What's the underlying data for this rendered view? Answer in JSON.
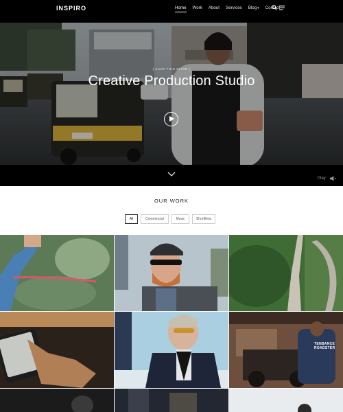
{
  "header": {
    "logo": "INSPIRO",
    "nav": [
      "Home",
      "Work",
      "About",
      "Services",
      "Blog",
      "Contact"
    ],
    "blog_caret": "▾"
  },
  "hero": {
    "eyebrow": "[ SAVE THIS SLIDE ]",
    "title": "Creative Production Studio",
    "play_label": "Play"
  },
  "work": {
    "title": "OUR WORK",
    "filters": [
      "All",
      "Commercial",
      "Music",
      "Shortfilms"
    ],
    "active_filter": "All",
    "tile_tag_line1": "TENBANCE",
    "tile_tag_line2": "ROADSTER"
  },
  "colors": {
    "header_bg": "#000000",
    "page_bg": "#ffffff",
    "accent_text": "#ffffff"
  }
}
